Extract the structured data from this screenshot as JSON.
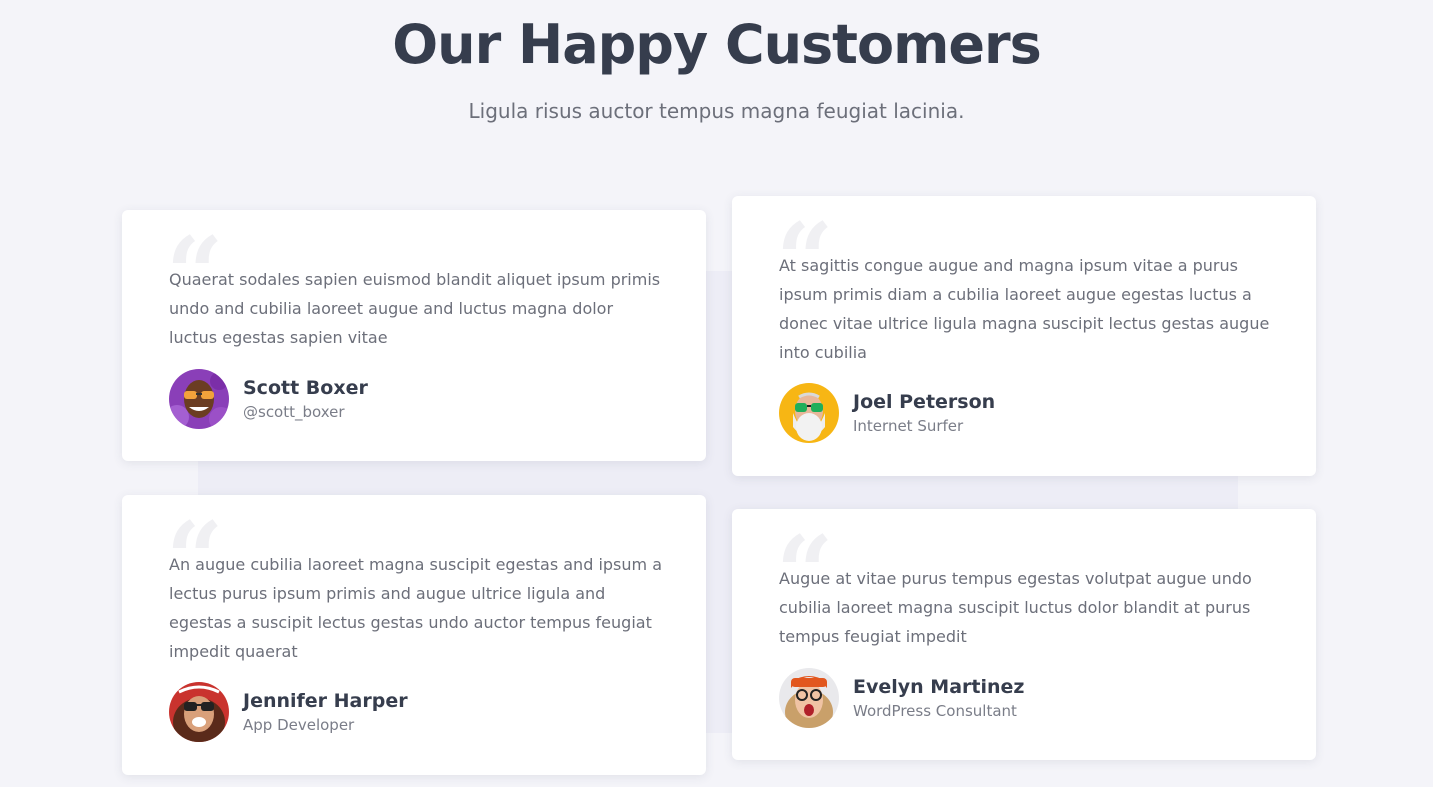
{
  "section": {
    "title": "Our Happy Customers",
    "subtitle": "Ligula risus auctor tempus magna feugiat lacinia."
  },
  "testimonials": [
    {
      "text": "Quaerat sodales sapien euismod blandit aliquet ipsum primis undo and cubilia laoreet augue and luctus magna dolor luctus egestas sapien vitae",
      "name": "Scott Boxer",
      "role": "@scott_boxer",
      "avatar": "scott-boxer-avatar"
    },
    {
      "text": "At sagittis congue augue and magna ipsum vitae a purus ipsum primis diam a cubilia laoreet augue egestas luctus a donec vitae ultrice ligula magna suscipit lectus gestas augue into cubilia",
      "name": "Joel Peterson",
      "role": "Internet Surfer",
      "avatar": "joel-peterson-avatar"
    },
    {
      "text": "An augue cubilia laoreet magna suscipit egestas and ipsum a lectus purus ipsum primis and augue ultrice ligula and egestas a suscipit lectus gestas undo auctor tempus feugiat impedit quaerat",
      "name": "Jennifer Harper",
      "role": "App Developer",
      "avatar": "jennifer-harper-avatar"
    },
    {
      "text": "Augue at vitae purus tempus egestas volutpat augue undo cubilia laoreet magna suscipit luctus dolor blandit at purus tempus feugiat impedit",
      "name": "Evelyn Martinez",
      "role": "WordPress Consultant",
      "avatar": "evelyn-martinez-avatar"
    }
  ],
  "colors": {
    "background": "#f4f4f9",
    "heading": "#363d4d",
    "body_text": "#6c6f7a",
    "card": "#ffffff"
  }
}
